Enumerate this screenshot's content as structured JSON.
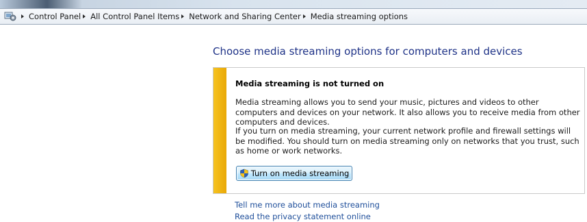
{
  "breadcrumb": {
    "items": [
      "Control Panel",
      "All Control Panel Items",
      "Network and Sharing Center",
      "Media streaming options"
    ]
  },
  "page": {
    "title": "Choose media streaming options for computers and devices"
  },
  "notice": {
    "heading": "Media streaming is not turned on",
    "paragraph1": "Media streaming allows you to send your music, pictures and videos to other computers and devices on your network.  It also allows you to receive media from other computers and devices.",
    "paragraph2": "If you turn on media streaming, your current network profile and firewall settings will be modified. You should turn on media streaming only on networks that you trust, such as home or work networks.",
    "button_label": "Turn on media streaming",
    "stripe_color": "#f0b414"
  },
  "links": {
    "tell_me_more": "Tell me more about media streaming",
    "privacy": "Read the privacy statement online"
  },
  "icons": {
    "breadcrumb_root": "control-panel-icon",
    "button": "uac-shield-icon"
  }
}
